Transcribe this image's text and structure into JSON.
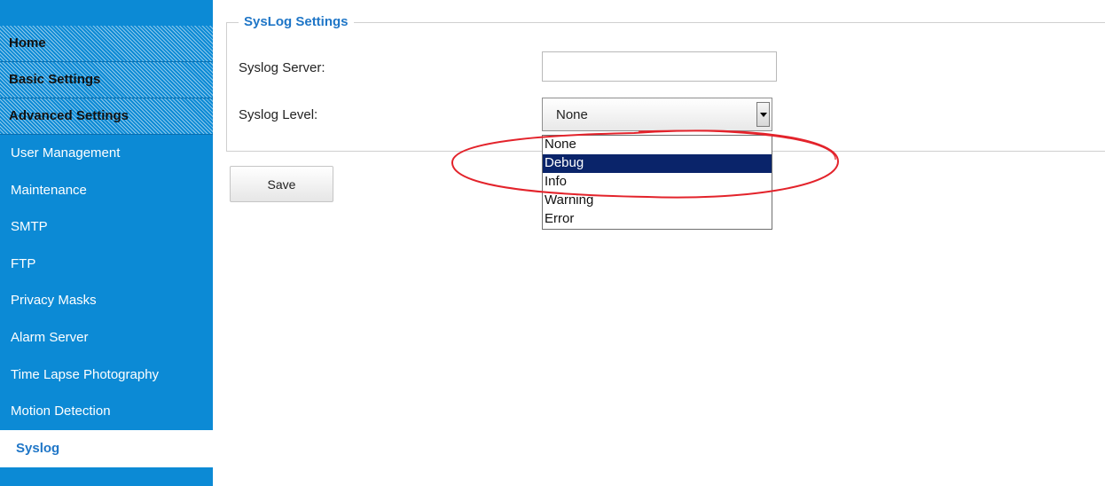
{
  "sidebar": {
    "headers": [
      {
        "label": "Home"
      },
      {
        "label": "Basic Settings"
      },
      {
        "label": "Advanced Settings"
      }
    ],
    "items": [
      {
        "label": "User Management"
      },
      {
        "label": "Maintenance"
      },
      {
        "label": "SMTP"
      },
      {
        "label": "FTP"
      },
      {
        "label": "Privacy Masks"
      },
      {
        "label": "Alarm Server"
      },
      {
        "label": "Time Lapse Photography"
      },
      {
        "label": "Motion Detection"
      },
      {
        "label": "Syslog"
      }
    ],
    "active_item": "Syslog"
  },
  "syslog_settings": {
    "legend": "SysLog Settings",
    "server_label": "Syslog Server:",
    "server_value": "",
    "level_label": "Syslog Level:",
    "level_value": "None",
    "level_options": [
      "None",
      "Debug",
      "Info",
      "Warning",
      "Error"
    ],
    "highlighted_option": "Debug"
  },
  "save_label": "Save",
  "colors": {
    "sidebar_blue": "#0c8ad5",
    "accent_text": "#1f76c7",
    "selected_option_bg": "#0a246a",
    "annotation_red": "#e3232b"
  }
}
